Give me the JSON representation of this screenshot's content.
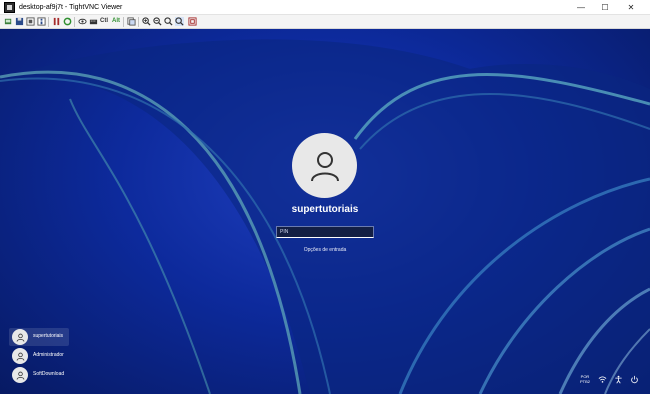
{
  "window": {
    "title": "desktop-af9j7t - TightVNC Viewer",
    "minimize": "—",
    "maximize": "☐",
    "close": "✕"
  },
  "toolbar": {
    "ctrl_alt_del": "Ctl",
    "alt": "Alt"
  },
  "lockscreen": {
    "username": "supertutoriais",
    "pin_placeholder": "PIN",
    "sign_in_options": "Opções de entrada"
  },
  "users": [
    {
      "name": "supertutoriais"
    },
    {
      "name": "Administrador"
    },
    {
      "name": "SoftDownload"
    }
  ],
  "tray": {
    "language_line1": "POR",
    "language_line2": "PTB2"
  }
}
